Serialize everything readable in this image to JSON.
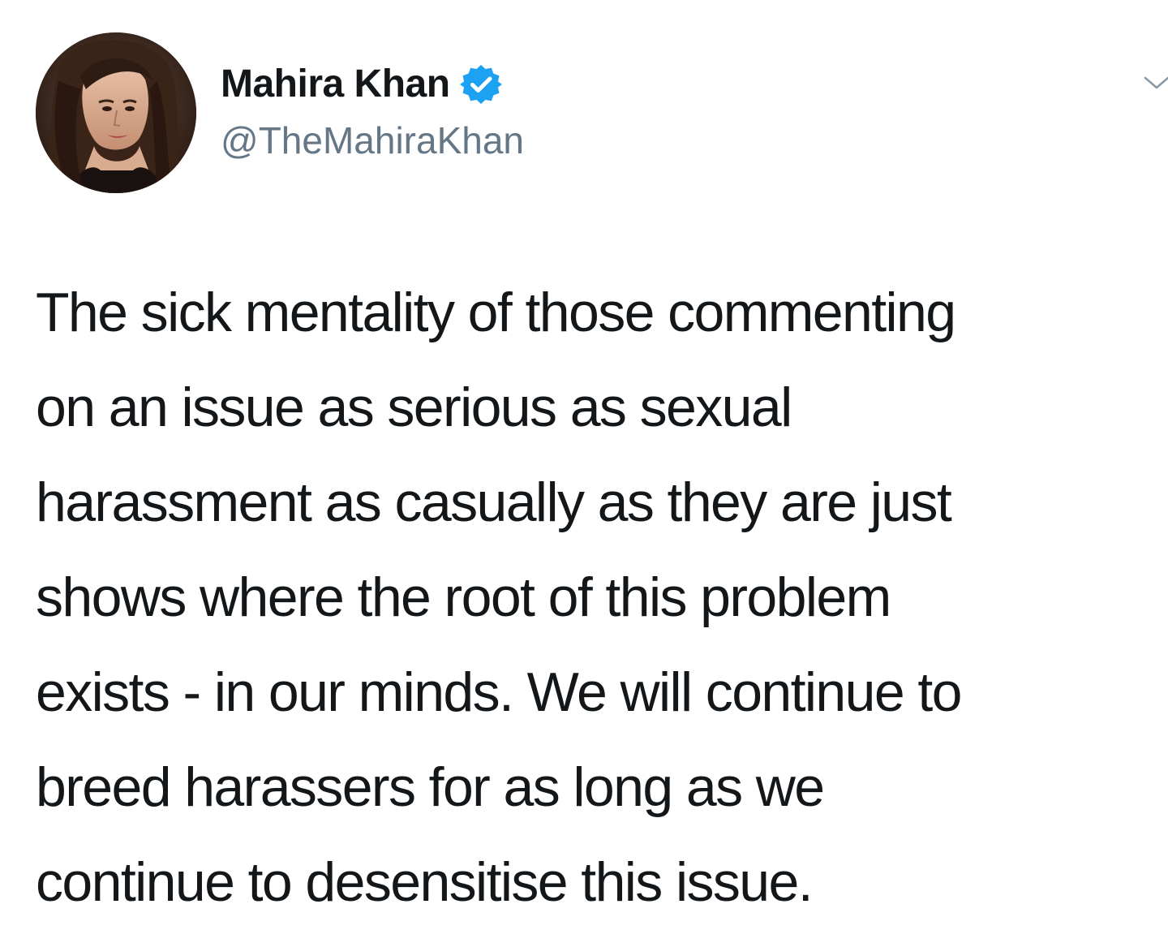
{
  "author": {
    "display_name": "Mahira Khan",
    "handle": "@TheMahiraKhan",
    "verified": true,
    "avatar_icon": "profile-photo",
    "verified_icon": "verified-badge-icon"
  },
  "tweet": {
    "lines": [
      "The sick mentality of those commenting",
      "on an issue as serious as sexual",
      "harassment as casually as they are just",
      "shows where the root of this problem",
      "exists - in our minds. We will continue to",
      "breed harassers for as long as we",
      "continue to desensitise this issue."
    ]
  },
  "menu": {
    "icon": "chevron-down-icon"
  },
  "colors": {
    "background": "#ffffff",
    "name_text": "#14171a",
    "handle_text": "#657786",
    "body_text": "#14171a",
    "verified_blue": "#1da1f2"
  }
}
